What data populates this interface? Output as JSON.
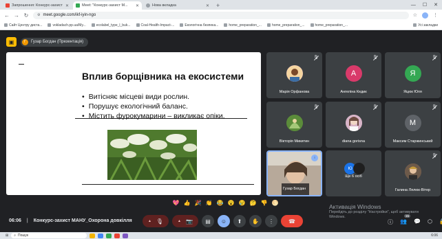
{
  "browser": {
    "tabs": [
      {
        "title": "Запрошення: Конкурс-захист",
        "favicon_color": "#ea4335",
        "active": false
      },
      {
        "title": "Meet: \"Конкурс-захист М...",
        "favicon_color": "#34a853",
        "active": true
      },
      {
        "title": "Нова вкладка",
        "favicon_color": "#9aa0a6",
        "active": false
      }
    ],
    "new_tab_label": "+",
    "url": "meet.google.com/ikf-iyin-ngo",
    "bookmarks": [
      "Сайт Центру диста...",
      "vokladach.pp.ua/My...",
      "ecolabel_type_l_buk...",
      "Coal-Health-Impact-...",
      "Екологічна безпека...",
      "home_preparation_...",
      "home_preparation_...",
      "home_preparation_..."
    ],
    "all_bookmarks_label": "Усі закладки"
  },
  "meet": {
    "presenter_label": "Гузар Богдан (Презентація)",
    "presenter_initial": "Г",
    "slide": {
      "title": "Вплив борщівника на екосистеми",
      "bullets": [
        "Витісняє місцеві види рослин.",
        "Порушує екологічний баланс.",
        "Містить фурокумарини – викликає опіки."
      ]
    },
    "participants": [
      {
        "name": "Марія Орфанова",
        "initial": "",
        "color": "#c58af9"
      },
      {
        "name": "Ангеліна Кедик",
        "initial": "А",
        "color": "#d93a6a"
      },
      {
        "name": "Яцюк Юля",
        "initial": "Я",
        "color": "#34a853"
      },
      {
        "name": "Вікторія Микитин",
        "initial": "",
        "color": "#5b8c3a"
      },
      {
        "name": "diana gorisna",
        "initial": "",
        "color": "#e8c8d0"
      },
      {
        "name": "Максим Старжинський",
        "initial": "М",
        "color": "#5f6368"
      },
      {
        "name": "Гузар Богдан",
        "initial": "",
        "color": "#4a4a4a"
      },
      {
        "name": "Ще 6 осіб",
        "initial": "Ю",
        "color": "#1a73e8"
      },
      {
        "name": "Галина Лялюк-Вітер",
        "initial": "",
        "color": "#8d6e63"
      }
    ],
    "reactions": [
      "💖",
      "👍",
      "🎉",
      "👏",
      "😂",
      "😮",
      "😢",
      "🤔",
      "👎",
      "🌕"
    ],
    "time": "06:06",
    "meeting_title": "Конкурс-захист МАНУ_Охорона довкілля",
    "people_count": "15",
    "windows_watermark": {
      "title": "Активація Windows",
      "subtitle": "Перейдіть до розділу \"Настройки\", щоб активувати Windows."
    }
  },
  "taskbar": {
    "search_placeholder": "Пошук",
    "clock": "6:06"
  }
}
